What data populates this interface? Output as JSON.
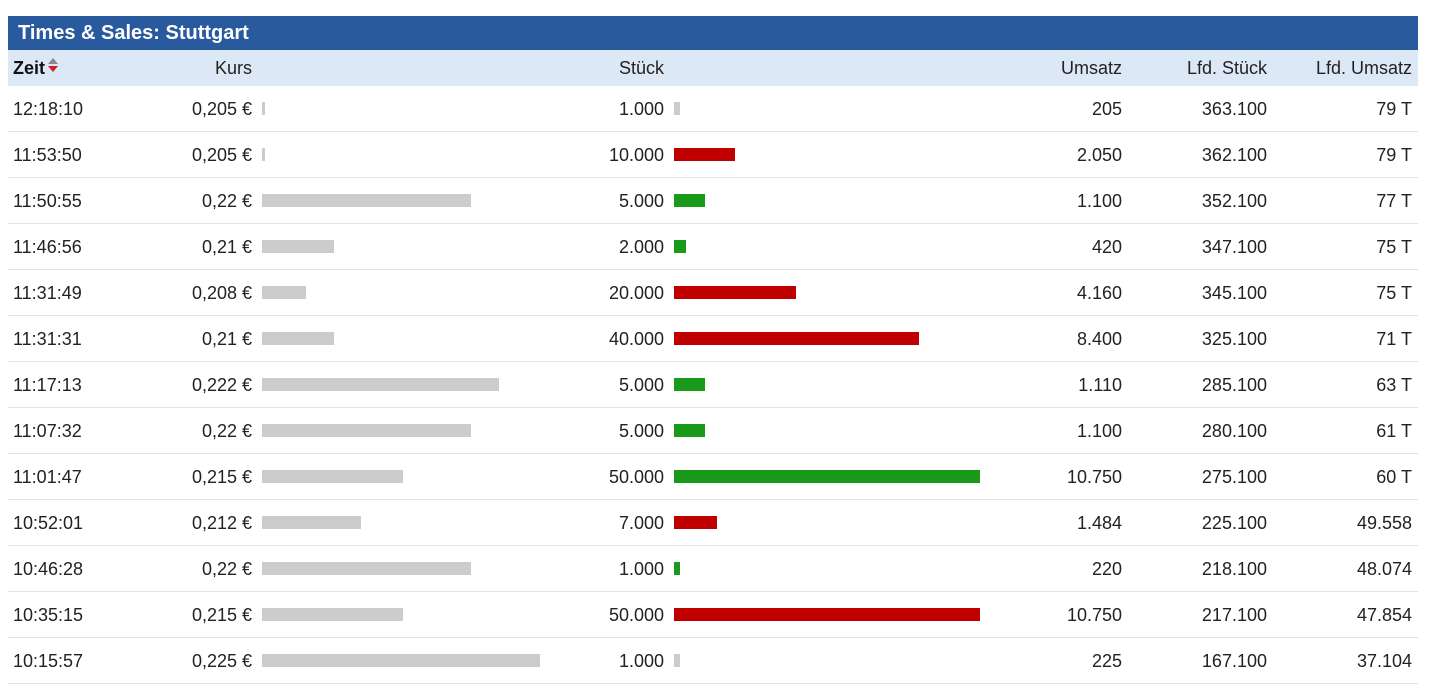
{
  "title": "Times & Sales: Stuttgart",
  "columns": {
    "zeit": "Zeit",
    "kurs": "Kurs",
    "stueck": "Stück",
    "umsatz": "Umsatz",
    "lfd_stueck": "Lfd. Stück",
    "lfd_umsatz": "Lfd. Umsatz"
  },
  "sort_icon": "sort-desc-icon",
  "colors": {
    "header_bg": "#2a5a9e",
    "column_header_bg": "#dde8f7",
    "price_bar": "#cccccc",
    "buy": "#1a9a1a",
    "sell": "#c00000",
    "neutral": "#cccccc"
  },
  "price_scale": [
    0.205,
    0.225
  ],
  "volume_scale_max": 50000,
  "rows": [
    {
      "zeit": "12:18:10",
      "kurs": "0,205 €",
      "kurs_value": 0.205,
      "stueck": "1.000",
      "stueck_value": 1000,
      "direction": "neutral",
      "umsatz": "205",
      "lfd_stueck": "363.100",
      "lfd_umsatz": "79 T"
    },
    {
      "zeit": "11:53:50",
      "kurs": "0,205 €",
      "kurs_value": 0.205,
      "stueck": "10.000",
      "stueck_value": 10000,
      "direction": "sell",
      "umsatz": "2.050",
      "lfd_stueck": "362.100",
      "lfd_umsatz": "79 T"
    },
    {
      "zeit": "11:50:55",
      "kurs": "0,22 €",
      "kurs_value": 0.22,
      "stueck": "5.000",
      "stueck_value": 5000,
      "direction": "buy",
      "umsatz": "1.100",
      "lfd_stueck": "352.100",
      "lfd_umsatz": "77 T"
    },
    {
      "zeit": "11:46:56",
      "kurs": "0,21 €",
      "kurs_value": 0.21,
      "stueck": "2.000",
      "stueck_value": 2000,
      "direction": "buy",
      "umsatz": "420",
      "lfd_stueck": "347.100",
      "lfd_umsatz": "75 T"
    },
    {
      "zeit": "11:31:49",
      "kurs": "0,208 €",
      "kurs_value": 0.208,
      "stueck": "20.000",
      "stueck_value": 20000,
      "direction": "sell",
      "umsatz": "4.160",
      "lfd_stueck": "345.100",
      "lfd_umsatz": "75 T"
    },
    {
      "zeit": "11:31:31",
      "kurs": "0,21 €",
      "kurs_value": 0.21,
      "stueck": "40.000",
      "stueck_value": 40000,
      "direction": "sell",
      "umsatz": "8.400",
      "lfd_stueck": "325.100",
      "lfd_umsatz": "71 T"
    },
    {
      "zeit": "11:17:13",
      "kurs": "0,222 €",
      "kurs_value": 0.222,
      "stueck": "5.000",
      "stueck_value": 5000,
      "direction": "buy",
      "umsatz": "1.110",
      "lfd_stueck": "285.100",
      "lfd_umsatz": "63 T"
    },
    {
      "zeit": "11:07:32",
      "kurs": "0,22 €",
      "kurs_value": 0.22,
      "stueck": "5.000",
      "stueck_value": 5000,
      "direction": "buy",
      "umsatz": "1.100",
      "lfd_stueck": "280.100",
      "lfd_umsatz": "61 T"
    },
    {
      "zeit": "11:01:47",
      "kurs": "0,215 €",
      "kurs_value": 0.215,
      "stueck": "50.000",
      "stueck_value": 50000,
      "direction": "buy",
      "umsatz": "10.750",
      "lfd_stueck": "275.100",
      "lfd_umsatz": "60 T"
    },
    {
      "zeit": "10:52:01",
      "kurs": "0,212 €",
      "kurs_value": 0.212,
      "stueck": "7.000",
      "stueck_value": 7000,
      "direction": "sell",
      "umsatz": "1.484",
      "lfd_stueck": "225.100",
      "lfd_umsatz": "49.558"
    },
    {
      "zeit": "10:46:28",
      "kurs": "0,22 €",
      "kurs_value": 0.22,
      "stueck": "1.000",
      "stueck_value": 1000,
      "direction": "buy",
      "umsatz": "220",
      "lfd_stueck": "218.100",
      "lfd_umsatz": "48.074"
    },
    {
      "zeit": "10:35:15",
      "kurs": "0,215 €",
      "kurs_value": 0.215,
      "stueck": "50.000",
      "stueck_value": 50000,
      "direction": "sell",
      "umsatz": "10.750",
      "lfd_stueck": "217.100",
      "lfd_umsatz": "47.854"
    },
    {
      "zeit": "10:15:57",
      "kurs": "0,225 €",
      "kurs_value": 0.225,
      "stueck": "1.000",
      "stueck_value": 1000,
      "direction": "neutral",
      "umsatz": "225",
      "lfd_stueck": "167.100",
      "lfd_umsatz": "37.104"
    }
  ]
}
